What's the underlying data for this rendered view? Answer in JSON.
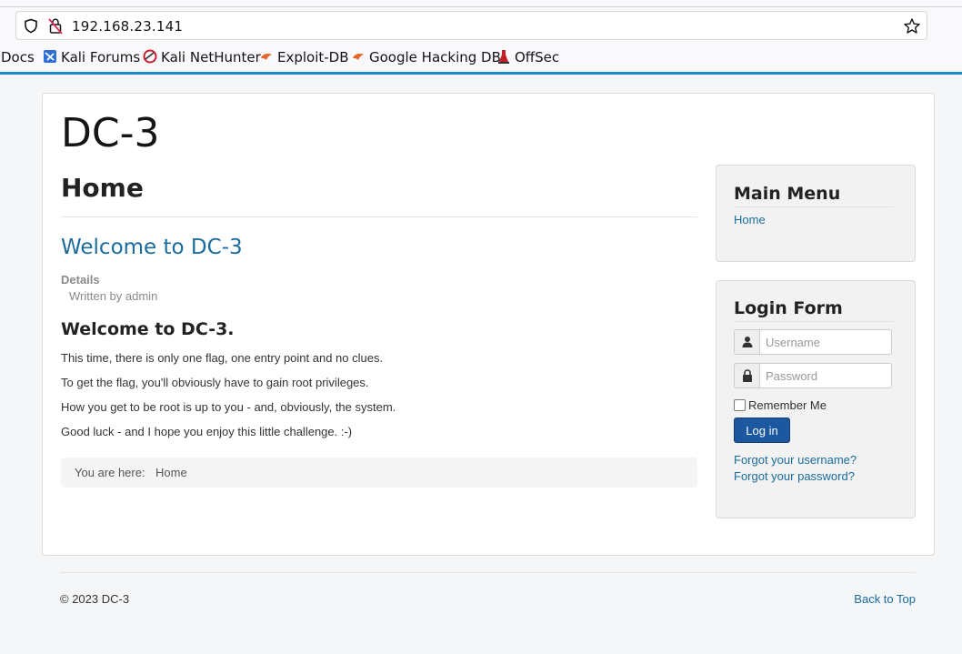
{
  "browser": {
    "url": "192.168.23.141",
    "bookmarks": [
      {
        "label": "Docs",
        "icon": "none"
      },
      {
        "label": "Kali Forums",
        "icon": "kali-forums-icon"
      },
      {
        "label": "Kali NetHunter",
        "icon": "kali-nethunter-icon"
      },
      {
        "label": "Exploit-DB",
        "icon": "exploit-db-icon"
      },
      {
        "label": "Google Hacking DB",
        "icon": "google-hacking-db-icon"
      },
      {
        "label": "OffSec",
        "icon": "offsec-icon"
      }
    ],
    "accent_color": "#1b8bd2"
  },
  "site": {
    "title": "DC-3",
    "page_heading": "Home"
  },
  "article": {
    "title": "Welcome to DC-3",
    "details_label": "Details",
    "written_by": "Written by admin",
    "subheading": "Welcome to DC-3.",
    "paragraphs": [
      "This time, there is only one flag, one entry point and no clues.",
      "To get the flag, you'll obviously have to gain root privileges.",
      "How you get to be root is up to you - and, obviously, the system.",
      "Good luck - and I hope you enjoy this little challenge.  :-)"
    ]
  },
  "breadcrumb": {
    "label": "You are here:",
    "current": "Home"
  },
  "main_menu": {
    "title": "Main Menu",
    "items": [
      "Home"
    ]
  },
  "login_form": {
    "title": "Login Form",
    "username_placeholder": "Username",
    "password_placeholder": "Password",
    "remember_label": "Remember Me",
    "submit_label": "Log in",
    "forgot_username": "Forgot your username?",
    "forgot_password": "Forgot your password?",
    "button_color": "#1b58a0"
  },
  "footer": {
    "copyright": "© 2023 DC-3",
    "back_to_top": "Back to Top"
  },
  "link_color": "#1a6c9c"
}
